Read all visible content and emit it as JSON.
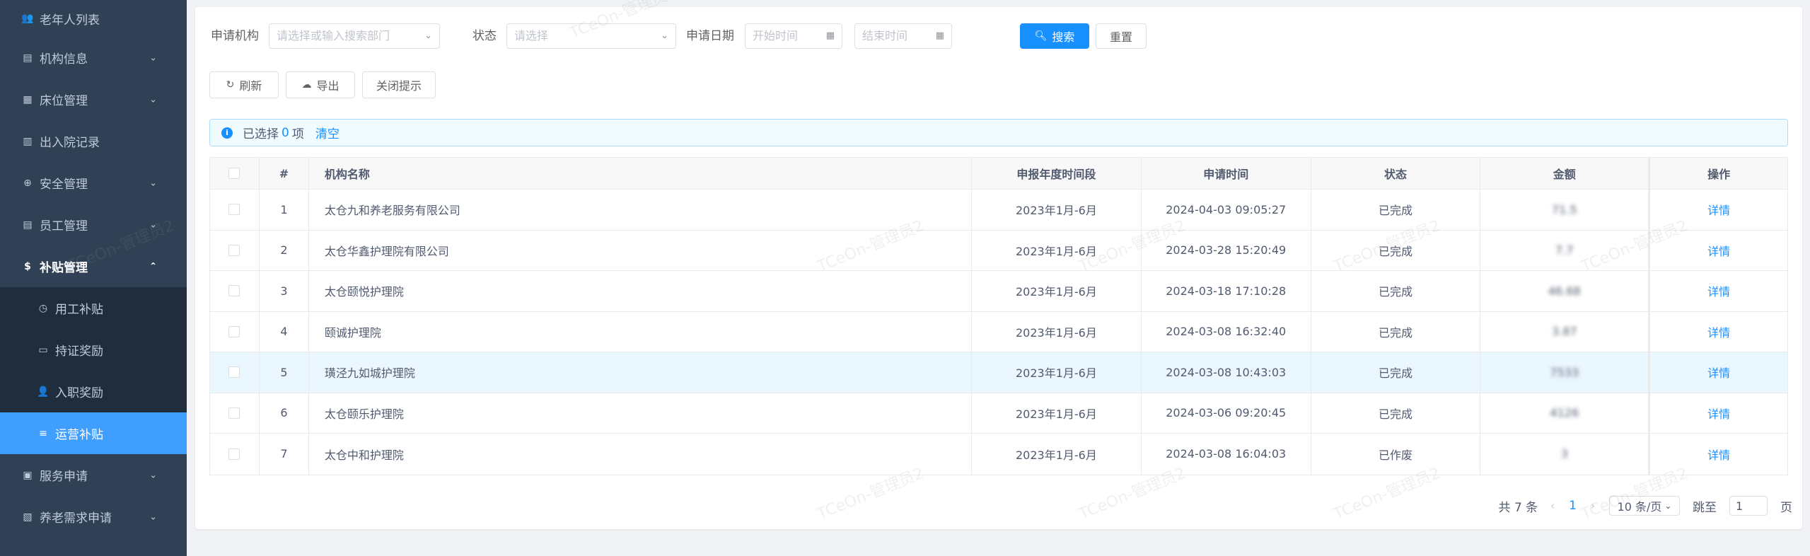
{
  "sidebar": {
    "items": [
      {
        "label": "老年人列表",
        "icon": "group-icon"
      },
      {
        "label": "机构信息",
        "icon": "database-icon"
      },
      {
        "label": "床位管理",
        "icon": "grid-icon"
      },
      {
        "label": "出入院记录",
        "icon": "table-icon"
      },
      {
        "label": "安全管理",
        "icon": "shield-icon"
      },
      {
        "label": "员工管理",
        "icon": "database-icon"
      },
      {
        "label": "补贴管理",
        "icon": "dollar-icon"
      },
      {
        "label": "服务申请",
        "icon": "calendar-icon"
      },
      {
        "label": "养老需求申请",
        "icon": "document-icon"
      }
    ],
    "subsidy_children": [
      {
        "label": "用工补贴",
        "icon": "clock-icon"
      },
      {
        "label": "持证奖励",
        "icon": "card-icon"
      },
      {
        "label": "入职奖励",
        "icon": "user-add-icon"
      },
      {
        "label": "运营补贴",
        "icon": "list-icon"
      }
    ]
  },
  "filters": {
    "org_label": "申请机构",
    "org_placeholder": "请选择或输入搜索部门",
    "status_label": "状态",
    "status_placeholder": "请选择",
    "date_label": "申请日期",
    "start_placeholder": "开始时间",
    "end_placeholder": "结束时间",
    "search_label": "搜索",
    "reset_label": "重置"
  },
  "toolbar": {
    "refresh_label": "刷新",
    "export_label": "导出",
    "close_tip_label": "关闭提示"
  },
  "alert": {
    "prefix": "已选择",
    "count": "0",
    "suffix": "项",
    "clear_label": "清空"
  },
  "table": {
    "headers": [
      "#",
      "机构名称",
      "申报年度时间段",
      "申请时间",
      "状态",
      "金额",
      "操作"
    ],
    "rows": [
      {
        "no": "1",
        "name": "太仓九和养老服务有限公司",
        "period": "2023年1月-6月",
        "time": "2024-04-03 09:05:27",
        "status": "已完成",
        "amount": "71.5",
        "action": "详情"
      },
      {
        "no": "2",
        "name": "太仓华鑫护理院有限公司",
        "period": "2023年1月-6月",
        "time": "2024-03-28 15:20:49",
        "status": "已完成",
        "amount": "7.7",
        "action": "详情"
      },
      {
        "no": "3",
        "name": "太仓颐悦护理院",
        "period": "2023年1月-6月",
        "time": "2024-03-18 17:10:28",
        "status": "已完成",
        "amount": "46.68",
        "action": "详情"
      },
      {
        "no": "4",
        "name": "颐诚护理院",
        "period": "2023年1月-6月",
        "time": "2024-03-08 16:32:40",
        "status": "已完成",
        "amount": "3.87",
        "action": "详情"
      },
      {
        "no": "5",
        "name": "璜泾九如城护理院",
        "period": "2023年1月-6月",
        "time": "2024-03-08 10:43:03",
        "status": "已完成",
        "amount": "7533",
        "action": "详情"
      },
      {
        "no": "6",
        "name": "太仓颐乐护理院",
        "period": "2023年1月-6月",
        "time": "2024-03-06 09:20:45",
        "status": "已完成",
        "amount": "4126",
        "action": "详情"
      },
      {
        "no": "7",
        "name": "太仓中和护理院",
        "period": "2023年1月-6月",
        "time": "2024-03-08 16:04:03",
        "status": "已作废",
        "amount": "3",
        "action": "详情"
      }
    ]
  },
  "pagination": {
    "total": "共 7 条",
    "current": "1",
    "page_size": "10 条/页",
    "jump_label": "跳至",
    "jump_value": "1",
    "page_unit": "页"
  },
  "watermark": "TCeOn-管理员2",
  "colors": {
    "sidebar": "#304156",
    "submenu": "#1f2d3d",
    "active": "#409eff",
    "primary": "#1890ff"
  }
}
